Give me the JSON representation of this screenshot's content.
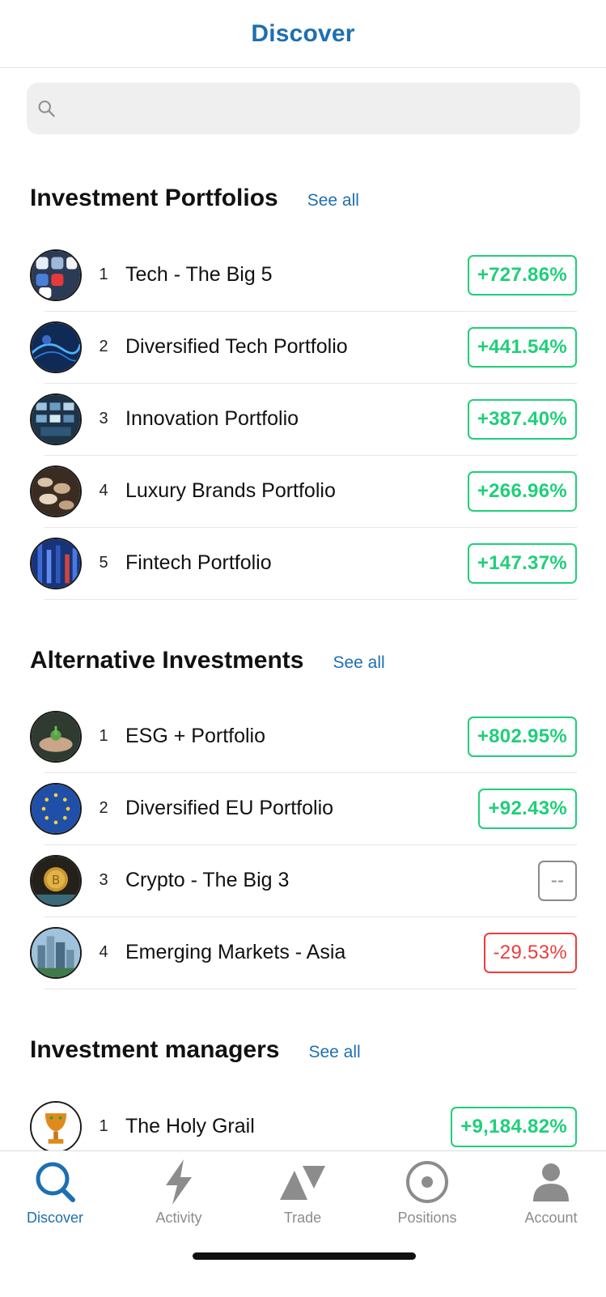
{
  "header": {
    "title": "Discover"
  },
  "search": {
    "placeholder": "",
    "value": ""
  },
  "sections": [
    {
      "title": "Investment Portfolios",
      "see_all": "See all",
      "items": [
        {
          "rank": "1",
          "name": "Tech - The Big 5",
          "change": "+727.86%",
          "status": "positive",
          "avatar_color": "#2b3a55"
        },
        {
          "rank": "2",
          "name": "Diversified Tech Portfolio",
          "change": "+441.54%",
          "status": "positive",
          "avatar_color": "#1b3b6f"
        },
        {
          "rank": "3",
          "name": "Innovation Portfolio",
          "change": "+387.40%",
          "status": "positive",
          "avatar_color": "#2a4a66"
        },
        {
          "rank": "4",
          "name": "Luxury Brands Portfolio",
          "change": "+266.96%",
          "status": "positive",
          "avatar_color": "#4a3a30"
        },
        {
          "rank": "5",
          "name": "Fintech Portfolio",
          "change": "+147.37%",
          "status": "positive",
          "avatar_color": "#1c3f8a"
        }
      ]
    },
    {
      "title": "Alternative Investments",
      "see_all": "See all",
      "items": [
        {
          "rank": "1",
          "name": "ESG + Portfolio",
          "change": "+802.95%",
          "status": "positive",
          "avatar_color": "#3a4a3a"
        },
        {
          "rank": "2",
          "name": "Diversified EU Portfolio",
          "change": "+92.43%",
          "status": "positive",
          "avatar_color": "#1f4fa8"
        },
        {
          "rank": "3",
          "name": "Crypto - The Big 3",
          "change": "--",
          "status": "neutral",
          "avatar_color": "#2e2a1f"
        },
        {
          "rank": "4",
          "name": "Emerging Markets - Asia",
          "change": "-29.53%",
          "status": "negative",
          "avatar_color": "#5f8aa8"
        }
      ]
    },
    {
      "title": "Investment managers",
      "see_all": "See all",
      "items": [
        {
          "rank": "1",
          "name": "The Holy Grail",
          "change": "+9,184.82%",
          "status": "positive",
          "avatar_color": "#e08a1e"
        }
      ]
    }
  ],
  "tabbar": {
    "items": [
      {
        "label": "Discover",
        "icon": "search-icon",
        "active": true
      },
      {
        "label": "Activity",
        "icon": "lightning-icon",
        "active": false
      },
      {
        "label": "Trade",
        "icon": "trade-icon",
        "active": false
      },
      {
        "label": "Positions",
        "icon": "positions-icon",
        "active": false
      },
      {
        "label": "Account",
        "icon": "person-icon",
        "active": false
      }
    ]
  },
  "colors": {
    "accent": "#1e6fb0",
    "positive": "#1fcf7a",
    "negative": "#ee3d3d",
    "neutral": "#8a8a8a"
  }
}
